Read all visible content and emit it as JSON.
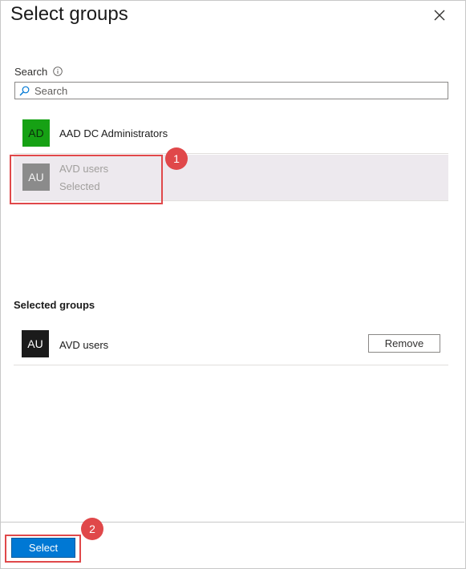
{
  "panel": {
    "title": "Select groups"
  },
  "search": {
    "label": "Search",
    "placeholder": "Search",
    "value": ""
  },
  "results": [
    {
      "initials": "AD",
      "name": "AAD DC Administrators",
      "status": ""
    },
    {
      "initials": "AU",
      "name": "AVD users",
      "status": "Selected"
    }
  ],
  "selected_section": {
    "title": "Selected groups",
    "items": [
      {
        "initials": "AU",
        "name": "AVD users",
        "remove_label": "Remove"
      }
    ]
  },
  "footer": {
    "select_label": "Select"
  },
  "callouts": [
    "1",
    "2"
  ],
  "colors": {
    "accent": "#0078d4",
    "callout": "#e0484a",
    "avatar_ad": "#16a114",
    "avatar_au_result": "#8b8b8b",
    "avatar_au_selected": "#1b1b1b",
    "selected_row_bg": "#ede9ee"
  },
  "icons": [
    "close-icon",
    "info-icon",
    "search-icon"
  ]
}
